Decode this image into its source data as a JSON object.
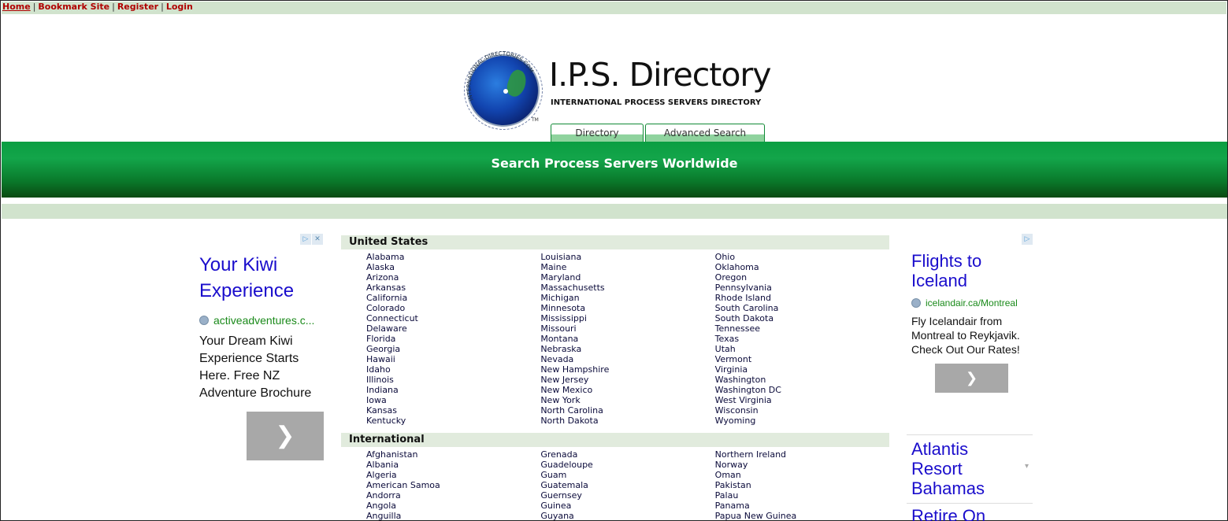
{
  "topnav": {
    "links": [
      "Home",
      "Bookmark Site",
      "Register",
      "Login"
    ]
  },
  "brand": {
    "title": "I.P.S. Directory",
    "subtitle": "INTERNATIONAL PROCESS SERVERS DIRECTORY",
    "globe_text": "INTERNATIONAL-DIRECTORIES.COM",
    "trademark": "TM"
  },
  "tabs": [
    "Directory",
    "Advanced Search"
  ],
  "banner": {
    "heading": "Search Process Servers Worldwide"
  },
  "ad_left": {
    "adchoices": [
      "▷",
      "✕"
    ],
    "headline": "Your Kiwi Experience",
    "url": "activeadventures.c...",
    "body": "Your Dream Kiwi Experience Starts Here. Free NZ Adventure Brochure",
    "button_icon": "chevron-right-icon",
    "button_glyph": "❯"
  },
  "ad_right": {
    "adchoices": "▷",
    "ad1": {
      "headline": "Flights to Iceland",
      "url": "icelandair.ca/Montreal",
      "body": "Fly Icelandair from Montreal to Reykjavik. Check Out Our Rates!",
      "button_glyph": "❯"
    },
    "ad2": {
      "headline": "Atlantis Resort Bahamas",
      "arrow": "▾"
    },
    "ad3": {
      "headline": "Retire On"
    }
  },
  "directory": {
    "us": {
      "heading": "United States",
      "col1": [
        "Alabama",
        "Alaska",
        "Arizona",
        "Arkansas",
        "California",
        "Colorado",
        "Connecticut",
        "Delaware",
        "Florida",
        "Georgia",
        "Hawaii",
        "Idaho",
        "Illinois",
        "Indiana",
        "Iowa",
        "Kansas",
        "Kentucky"
      ],
      "col2": [
        "Louisiana",
        "Maine",
        "Maryland",
        "Massachusetts",
        "Michigan",
        "Minnesota",
        "Mississippi",
        "Missouri",
        "Montana",
        "Nebraska",
        "Nevada",
        "New Hampshire",
        "New Jersey",
        "New Mexico",
        "New York",
        "North Carolina",
        "North Dakota"
      ],
      "col3": [
        "Ohio",
        "Oklahoma",
        "Oregon",
        "Pennsylvania",
        "Rhode Island",
        "South Carolina",
        "South Dakota",
        "Tennessee",
        "Texas",
        "Utah",
        "Vermont",
        "Virginia",
        "Washington",
        "Washington DC",
        "West Virginia",
        "Wisconsin",
        "Wyoming"
      ]
    },
    "intl": {
      "heading": "International",
      "col1": [
        "Afghanistan",
        "Albania",
        "Algeria",
        "American Samoa",
        "Andorra",
        "Angola",
        "Anguilla"
      ],
      "col2": [
        "Grenada",
        "Guadeloupe",
        "Guam",
        "Guatemala",
        "Guernsey",
        "Guinea",
        "Guyana"
      ],
      "col3": [
        "Northern Ireland",
        "Norway",
        "Oman",
        "Pakistan",
        "Palau",
        "Panama",
        "Papua New Guinea"
      ]
    }
  }
}
